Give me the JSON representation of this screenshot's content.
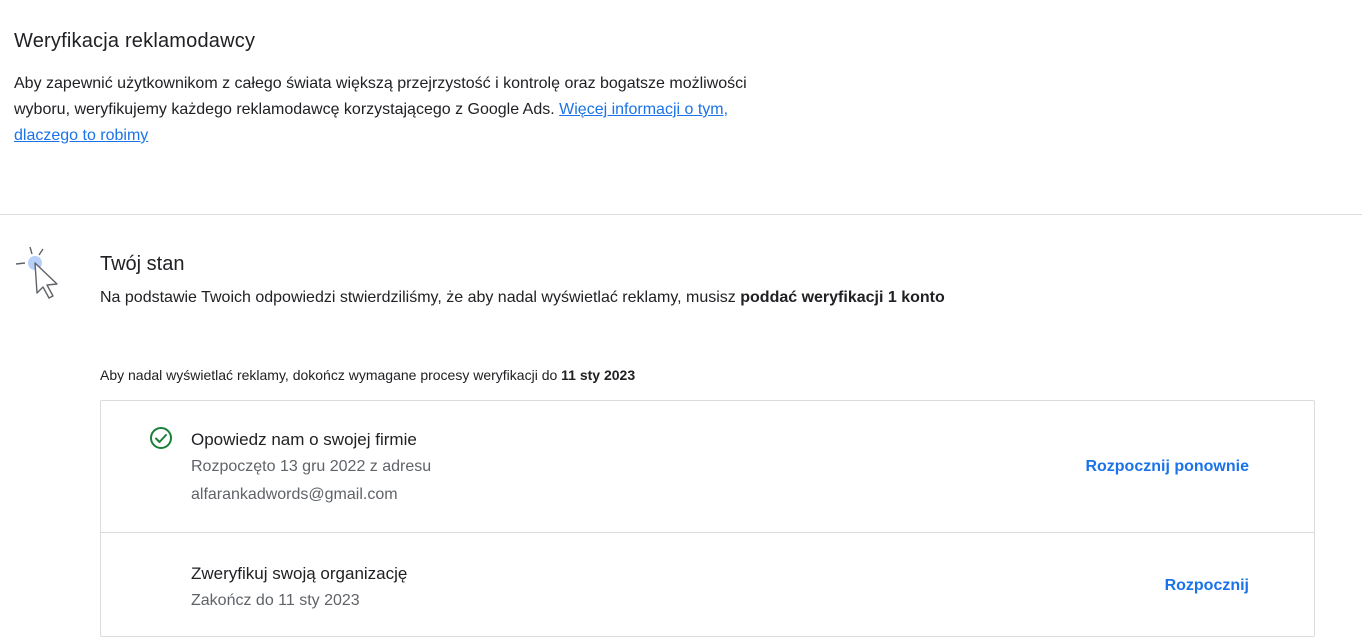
{
  "header": {
    "title": "Weryfikacja reklamodawcy",
    "intro_text": "Aby zapewnić użytkownikom z całego świata większą przejrzystość i kontrolę oraz bogatsze możliwości wyboru, weryfikujemy każdego reklamodawcę korzystającego z Google Ads. ",
    "intro_link": "Więcej informacji o tym, dlaczego to robimy"
  },
  "status": {
    "icon": "cursor-click-icon",
    "title": "Twój stan",
    "desc_prefix": "Na podstawie Twoich odpowiedzi stwierdziliśmy, że aby nadal wyświetlać reklamy, musisz ",
    "desc_bold": "poddać weryfikacji 1 konto"
  },
  "deadline": {
    "prefix": "Aby nadal wyświetlać reklamy, dokończ wymagane procesy weryfikacji do ",
    "date": "11 sty 2023"
  },
  "steps": [
    {
      "title": "Opowiedz nam o swojej firmie",
      "sub_line1": "Rozpoczęto 13 gru 2022 z adresu",
      "sub_line2": "alfarankadwords@gmail.com",
      "action": "Rozpocznij ponownie",
      "completed": true
    },
    {
      "title": "Zweryfikuj swoją organizację",
      "sub_line1": "Zakończ do 11 sty 2023",
      "action": "Rozpocznij",
      "completed": false
    }
  ],
  "colors": {
    "link": "#1a73e8",
    "check": "#188038",
    "divider": "#dadce0"
  }
}
